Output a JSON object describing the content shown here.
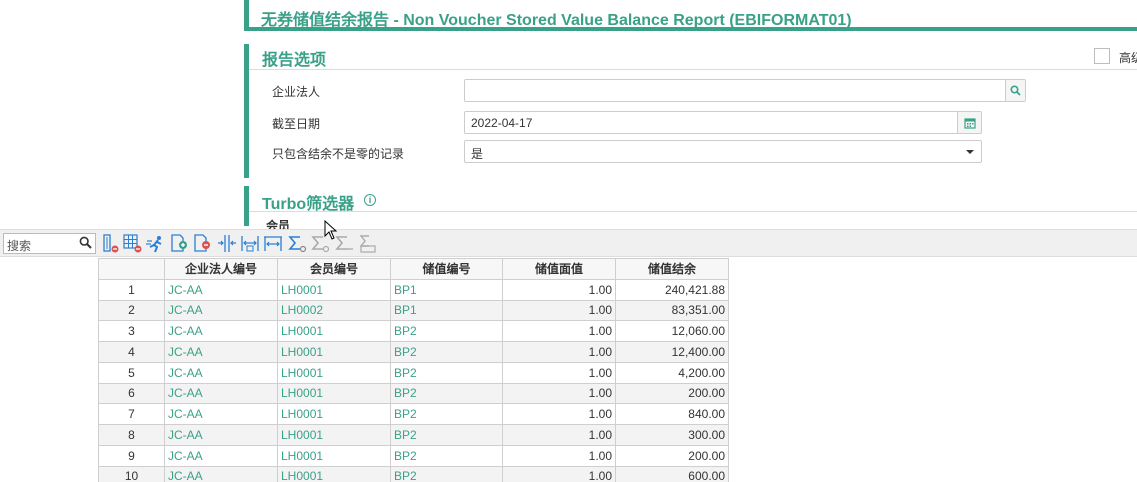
{
  "page": {
    "title": "无券储值结余报告 - Non Voucher Stored Value Balance Report (EBIFORMAT01)"
  },
  "options": {
    "section_title": "报告选项",
    "advanced_label": "高级",
    "fields": {
      "entity_label": "企业法人",
      "entity_value": "",
      "cutoff_label": "截至日期",
      "cutoff_value": "2022-04-17",
      "nonzero_label": "只包含结余不是零的记录",
      "nonzero_value": "是"
    }
  },
  "turbo": {
    "section_title": "Turbo筛选器",
    "member_label": "会员"
  },
  "toolbar": {
    "search_placeholder": "搜索",
    "icons": [
      "column-remove-icon",
      "grid-remove-icon",
      "run-icon",
      "add-row-icon",
      "remove-row-icon",
      "split-column-icon",
      "fit-column-icon",
      "expand-column-icon",
      "sum-icon",
      "sum-disabled-icon",
      "sum-disabled-icon-2",
      "export-icon"
    ]
  },
  "grid": {
    "headers": [
      "",
      "企业法人编号",
      "会员编号",
      "储值编号",
      "储值面值",
      "储值结余"
    ],
    "rows": [
      {
        "n": "1",
        "entity": "JC-AA",
        "member": "LH0001",
        "sv": "BP1",
        "face": "1.00",
        "bal": "240,421.88"
      },
      {
        "n": "2",
        "entity": "JC-AA",
        "member": "LH0002",
        "sv": "BP1",
        "face": "1.00",
        "bal": "83,351.00"
      },
      {
        "n": "3",
        "entity": "JC-AA",
        "member": "LH0001",
        "sv": "BP2",
        "face": "1.00",
        "bal": "12,060.00"
      },
      {
        "n": "4",
        "entity": "JC-AA",
        "member": "LH0001",
        "sv": "BP2",
        "face": "1.00",
        "bal": "12,400.00"
      },
      {
        "n": "5",
        "entity": "JC-AA",
        "member": "LH0001",
        "sv": "BP2",
        "face": "1.00",
        "bal": "4,200.00"
      },
      {
        "n": "6",
        "entity": "JC-AA",
        "member": "LH0001",
        "sv": "BP2",
        "face": "1.00",
        "bal": "200.00"
      },
      {
        "n": "7",
        "entity": "JC-AA",
        "member": "LH0001",
        "sv": "BP2",
        "face": "1.00",
        "bal": "840.00"
      },
      {
        "n": "8",
        "entity": "JC-AA",
        "member": "LH0001",
        "sv": "BP2",
        "face": "1.00",
        "bal": "300.00"
      },
      {
        "n": "9",
        "entity": "JC-AA",
        "member": "LH0001",
        "sv": "BP2",
        "face": "1.00",
        "bal": "200.00"
      },
      {
        "n": "10",
        "entity": "JC-AA",
        "member": "LH0001",
        "sv": "BP2",
        "face": "1.00",
        "bal": "600.00"
      }
    ]
  },
  "colors": {
    "accent": "#3aa189",
    "icon_blue": "#2a7fd4",
    "icon_red": "#d9534f"
  }
}
